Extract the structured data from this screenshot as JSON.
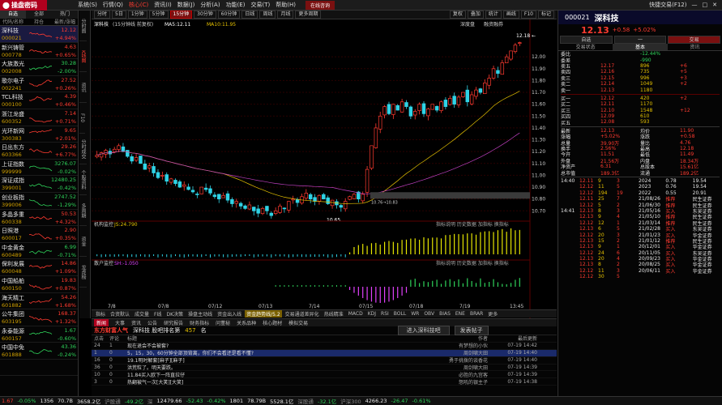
{
  "app": {
    "logo": "操盘密码",
    "menu": [
      "系统(S)",
      "行情(Q)",
      "核心(C)",
      "资讯(I)",
      "数据(J)",
      "分析(A)",
      "功能(E)",
      "交易(T)",
      "帮助(H)"
    ],
    "active_menu": "核心(C)",
    "alert": "在线咨询",
    "quick": "快捷交易(F12)",
    "window_ctrls": [
      "—",
      "□",
      "✕"
    ]
  },
  "left": {
    "tabs": [
      "自选",
      "全部",
      "热门"
    ],
    "active_tab": "自选",
    "subtabs": [
      "代码/名称",
      "持仓",
      "最新/涨幅"
    ],
    "stocks": [
      {
        "name": "深科技",
        "code": "000021",
        "price": "12.12",
        "pct": "+4.94%",
        "dir": "up"
      },
      {
        "name": "新兴铸管",
        "code": "000778",
        "price": "4.63",
        "pct": "+0.65%",
        "dir": "up"
      },
      {
        "name": "大族激光",
        "code": "002008",
        "price": "30.28",
        "pct": "-2.00%",
        "dir": "down"
      },
      {
        "name": "歌尔电子",
        "code": "002241",
        "price": "27.52",
        "pct": "+0.26%",
        "dir": "up"
      },
      {
        "name": "TCL科技",
        "code": "000100",
        "price": "4.39",
        "pct": "+0.46%",
        "dir": "up"
      },
      {
        "name": "浙江龙盛",
        "code": "600352",
        "price": "7.14",
        "pct": "+0.71%",
        "dir": "up"
      },
      {
        "name": "光环新网",
        "code": "300383",
        "price": "9.65",
        "pct": "+2.01%",
        "dir": "up"
      },
      {
        "name": "日出东方",
        "code": "603366",
        "price": "29.26",
        "pct": "+6.77%",
        "dir": "up"
      },
      {
        "name": "上证指数",
        "code": "999999",
        "price": "3276.07",
        "pct": "-0.02%",
        "dir": "down"
      },
      {
        "name": "深证成指",
        "code": "399001",
        "price": "12480.25",
        "pct": "-0.42%",
        "dir": "down"
      },
      {
        "name": "创业板指",
        "code": "399006",
        "price": "2747.52",
        "pct": "-1.29%",
        "dir": "down"
      },
      {
        "name": "多晶多重",
        "code": "600338",
        "price": "50.53",
        "pct": "+4.32%",
        "dir": "up"
      },
      {
        "name": "日照港",
        "code": "600017",
        "price": "2.90",
        "pct": "+0.35%",
        "dir": "up"
      },
      {
        "name": "中金黄金",
        "code": "600489",
        "price": "6.99",
        "pct": "-0.71%",
        "dir": "down"
      },
      {
        "name": "保利发展",
        "code": "600048",
        "price": "14.86",
        "pct": "+1.09%",
        "dir": "up"
      },
      {
        "name": "中国船舶",
        "code": "600150",
        "price": "19.83",
        "pct": "+0.87%",
        "dir": "up"
      },
      {
        "name": "海天精工",
        "code": "601882",
        "price": "54.26",
        "pct": "+1.68%",
        "dir": "up"
      },
      {
        "name": "公牛集团",
        "code": "603195",
        "price": "168.37",
        "pct": "+1.32%",
        "dir": "up"
      },
      {
        "name": "永泰能源",
        "code": "600157",
        "price": "1.67",
        "pct": "-0.60%",
        "dir": "down"
      },
      {
        "name": "中国中免",
        "code": "601888",
        "price": "43.36",
        "pct": "-0.24%",
        "dir": "down"
      },
      {
        "name": "",
        "code": "",
        "price": "",
        "pct": "",
        "dir": "up"
      }
    ]
  },
  "vtabs": [
    "分时图",
    "K线图",
    "资讯",
    "F10",
    "分时成交",
    "个股资料",
    "多周期",
    "资金",
    "龙虎榜"
  ],
  "active_vtab": "K线图",
  "periods": [
    "分时",
    "5日",
    "1分钟",
    "5分钟",
    "15分钟",
    "30分钟",
    "60分钟",
    "日线",
    "周线",
    "月线",
    "更多周期"
  ],
  "active_period": "15分钟",
  "toolbar_right": [
    "复权",
    "叠加",
    "统计",
    "画线",
    "F10",
    "标记"
  ],
  "chart_info": {
    "name": "深科技",
    "period": "(15分钟线 前复权)",
    "ma1": "MA5:12.11",
    "ma2": "MA10:11.95",
    "high_label": "12.18 ←",
    "low_label": "10.65",
    "mid_label": "10.76→10.83",
    "right_tags": [
      "深度盘",
      "融资融券"
    ]
  },
  "chart_data": {
    "type": "candlestick",
    "y_ticks": [
      "12.00",
      "11.90",
      "11.80",
      "11.70",
      "11.60",
      "11.50",
      "11.40",
      "11.30",
      "11.20",
      "11.10",
      "11.00",
      "10.90",
      "10.80",
      "10.70"
    ],
    "ylim": [
      10.62,
      12.22
    ],
    "x_ticks": [
      "7/8",
      "07/8",
      "07/12",
      "07/13",
      "7/14",
      "07/15",
      "07/18",
      "7/19",
      "13:45"
    ],
    "closes": [
      11.17,
      11.19,
      11.21,
      11.18,
      11.22,
      11.25,
      11.2,
      11.16,
      11.12,
      11.15,
      11.1,
      11.05,
      11.08,
      11.02,
      10.98,
      11.0,
      10.95,
      10.97,
      10.93,
      10.9,
      10.92,
      10.88,
      10.86,
      10.84,
      10.9,
      10.88,
      10.85,
      10.82,
      10.8,
      10.83,
      10.79,
      10.76,
      10.78,
      10.74,
      10.72,
      10.75,
      10.7,
      10.68,
      10.72,
      10.7,
      10.66,
      10.7,
      10.74,
      10.72,
      10.78,
      10.8,
      10.77,
      10.82,
      10.85,
      10.8,
      10.78,
      10.83,
      10.8,
      10.76,
      10.79,
      10.75,
      10.73,
      10.78,
      10.82,
      10.84,
      10.8,
      10.84,
      11.05,
      11.25,
      11.4,
      11.5,
      11.58,
      11.52,
      11.6,
      11.55,
      11.62,
      11.58,
      11.5,
      11.54,
      11.6,
      11.52,
      11.56,
      11.6,
      11.55,
      11.62,
      11.58,
      11.65,
      11.6,
      11.66,
      11.7,
      11.62,
      11.68,
      11.72,
      11.7,
      11.78,
      11.82,
      11.9,
      11.86,
      11.95,
      12.0,
      12.05,
      12.1,
      12.12
    ]
  },
  "macro": {
    "label": "机构监控",
    "val": "JS:24.790",
    "right": "指标说明 历史数据 加指标 换指标"
  },
  "vol": {
    "label": "散户监控",
    "val": "SH:-1.050",
    "right": "指标说明 历史数据 加指标 换指标"
  },
  "macro_tabs": [
    "指标",
    "合资默认",
    "成交量",
    "F线",
    "DK决策",
    "操盘主动线",
    "资金出入线",
    "资金趋势线/5.2",
    "交易通道差异化",
    "热线精准",
    "MACD",
    "KDJ",
    "RSI",
    "BOLL",
    "WR",
    "OBV",
    "BIAS",
    "ENE",
    "BRAR",
    "更多"
  ],
  "active_macro": "资金趋势线/5.2",
  "news": {
    "tabs": [
      "新闻",
      "大事",
      "资讯",
      "公告",
      "研究报告",
      "财务指标",
      "问董秘",
      "关系品种",
      "核心题材",
      "模拟交易"
    ],
    "active": "新闻",
    "title": "东方财富人气",
    "subtitle": "深科技 股吧排名第",
    "rank": "457",
    "rank_unit": "名",
    "btn1": "进入深科技吧",
    "btn2": "发表帖子",
    "cols": [
      "点击",
      "评论",
      "标题",
      "作者",
      "最后更新"
    ],
    "rows": [
      {
        "c1": "24",
        "c2": "1",
        "c3": "现在退会不会被套?",
        "c4": "有梦想的小伙",
        "c5": "07-19 14:42"
      },
      {
        "c1": "1",
        "c2": "0",
        "c3": "5，15，30，60分钟全部顶背离，你们不会看还是看不懂?",
        "c4": "周剑啸大田",
        "c5": "07-19 14:40"
      },
      {
        "c1": "16",
        "c2": "0",
        "c3": "19.1明时解套[麻子][麻子]",
        "c4": "勇于挑拨的谈香花",
        "c5": "07-19 14:40"
      },
      {
        "c1": "36",
        "c2": "0",
        "c3": "洪荒粒了。明天要跌。",
        "c4": "周剑啸大田",
        "c5": "07-19 14:39"
      },
      {
        "c1": "10",
        "c2": "0",
        "c3": "11.84买入欧下一阵直拉仔",
        "c4": "必胜的九宫客",
        "c5": "07-19 14:39"
      },
      {
        "c1": "3",
        "c2": "0",
        "c3": "热翻被气一次[大笑][大笑]",
        "c4": "怒吼的银主子",
        "c5": "07-19 14:38"
      }
    ]
  },
  "right": {
    "code": "000021",
    "name": "深科技",
    "price": "12.13",
    "chg": "+0.58",
    "pct": "+5.02%",
    "btns": [
      "自选",
      "一",
      "交易"
    ],
    "tabs": [
      "交易状态",
      "基本",
      "资讯"
    ],
    "tcol": [
      [
        "委比",
        "-12.44%"
      ],
      [
        "委差",
        "-990"
      ]
    ],
    "asks": [
      [
        "卖五",
        "12.17",
        "896",
        "+6"
      ],
      [
        "卖四",
        "12.16",
        "735",
        "+5"
      ],
      [
        "卖三",
        "12.15",
        "996",
        "+3"
      ],
      [
        "卖二",
        "12.14",
        "1049",
        "+2"
      ],
      [
        "卖一",
        "12.13",
        "1180",
        ""
      ]
    ],
    "bids": [
      [
        "买一",
        "12.12",
        "420",
        "+2"
      ],
      [
        "买二",
        "12.11",
        "1170",
        ""
      ],
      [
        "买三",
        "12.10",
        "1548",
        "+12"
      ],
      [
        "买四",
        "12.09",
        "610",
        ""
      ],
      [
        "买五",
        "12.08",
        "593",
        ""
      ]
    ],
    "basic": [
      [
        "收益",
        "0.155",
        "PE(动)",
        "19.54"
      ],
      [
        "净资产",
        "6.31",
        "市净率",
        "1.92"
      ],
      [
        "每股收益",
        "0.155",
        "市值(亿)",
        "189.3"
      ]
    ],
    "stats": [
      [
        "最新",
        "12.13",
        "均价",
        "11.90"
      ],
      [
        "涨幅",
        "+5.02%",
        "涨跌",
        "+0.58"
      ],
      [
        "总量",
        "39.90万",
        "量比",
        "4.76"
      ],
      [
        "换手",
        "2.56%",
        "最高",
        "12.18"
      ],
      [
        "今开",
        "11.51",
        "最低",
        "11.49"
      ],
      [
        "外盘",
        "21.56万",
        "内盘",
        "18.34万"
      ],
      [
        "净资产",
        "6.31",
        "总股本",
        "15.61亿"
      ],
      [
        "总市值",
        "189.3亿",
        "流通",
        "189.2亿"
      ]
    ],
    "ticks": [
      [
        "14:40",
        "12.11",
        "9",
        "3"
      ],
      [
        "",
        "12.12",
        "11",
        "5"
      ],
      [
        "",
        "12.12",
        "194",
        "19"
      ],
      [
        "",
        "12.11",
        "25",
        "7"
      ],
      [
        "",
        "12.12",
        "5",
        "2"
      ],
      [
        "14:41",
        "12.13",
        "8",
        "3"
      ],
      [
        "",
        "12.13",
        "9",
        "4"
      ],
      [
        "",
        "12.12",
        "12",
        "1"
      ],
      [
        "",
        "12.13",
        "6",
        "5"
      ],
      [
        "",
        "12.12",
        "20",
        "3"
      ],
      [
        "",
        "12.13",
        "15",
        "2"
      ],
      [
        "",
        "12.13",
        "9",
        "1"
      ],
      [
        "",
        "12.12",
        "24",
        "6"
      ],
      [
        "",
        "12.13",
        "20",
        "4"
      ],
      [
        "",
        "12.13",
        "8",
        "2"
      ],
      [
        "",
        "12.12",
        "11",
        "3"
      ],
      [
        "",
        "12.12",
        "30",
        "5"
      ]
    ],
    "right_list": [
      [
        "21/08/26",
        "推荐",
        "民生证券"
      ],
      [
        "21/06/30",
        "推荐",
        "民生证券"
      ],
      [
        "21/05/16",
        "买入",
        "东吴证券"
      ],
      [
        "21/05/10",
        "推荐",
        "民生证券"
      ],
      [
        "21/03/14",
        "推荐",
        "民生证券"
      ],
      [
        "21/02/28",
        "买入",
        "东吴证券"
      ],
      [
        "21/01/23",
        "买入",
        "华金证券"
      ],
      [
        "21/01/12",
        "推荐",
        "民生证券"
      ],
      [
        "20/12/01",
        "买入",
        "华金证券"
      ],
      [
        "20/11/05",
        "买入",
        "东吴证券"
      ],
      [
        "20/09/23",
        "买入",
        "华金证券"
      ],
      [
        "20/08/25",
        "买入",
        "华金证券"
      ],
      [
        "20/06/11",
        "买入",
        "华金证券"
      ],
      [
        "20/04/12",
        "买入",
        "华金证券"
      ],
      [
        "20/03/15",
        "买入",
        "华金证券"
      ],
      [
        "19/10/11",
        "买入",
        "国信证券"
      ]
    ],
    "year_rows": [
      [
        "2024",
        "0.78",
        "19.54"
      ],
      [
        "2023",
        "0.76",
        "19.54"
      ],
      [
        "2022",
        "0.55",
        "20.91"
      ]
    ]
  },
  "status": {
    "items": [
      [
        "1.67",
        "red"
      ],
      [
        "-0.05%",
        "grn"
      ],
      [
        "1356",
        "wht"
      ],
      [
        "70.7B",
        "wht"
      ],
      [
        "3658.2亿",
        "wht"
      ],
      [
        "沪股通",
        "gry"
      ],
      [
        "-49.2亿",
        "grn"
      ],
      [
        "深",
        "gry"
      ],
      [
        "12479.66",
        "wht"
      ],
      [
        "-52.43",
        "grn"
      ],
      [
        "-0.42%",
        "grn"
      ],
      [
        "1801",
        "wht"
      ],
      [
        "78.79B",
        "wht"
      ],
      [
        "5528.1亿",
        "wht"
      ],
      [
        "深股通",
        "gry"
      ],
      [
        "-32.1亿",
        "grn"
      ],
      [
        "沪深300",
        "gry"
      ],
      [
        "4266.23",
        "wht"
      ],
      [
        "-26.47",
        "grn"
      ],
      [
        "-0.61%",
        "grn"
      ]
    ]
  }
}
